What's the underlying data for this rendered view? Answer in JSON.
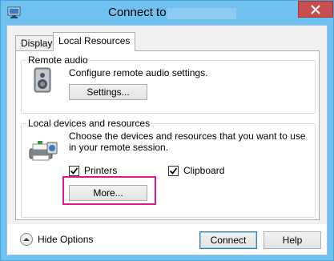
{
  "window": {
    "title": "Connect to",
    "close_glyph": "×"
  },
  "tabs": [
    {
      "label": "Display"
    },
    {
      "label": "Local Resources"
    }
  ],
  "remote_audio": {
    "legend": "Remote audio",
    "description": "Configure remote audio settings.",
    "settings_button": "Settings...",
    "icon": "speaker-icon"
  },
  "local_devices": {
    "legend": "Local devices and resources",
    "description": "Choose the devices and resources that you want to use in your remote session.",
    "printers_label": "Printers",
    "printers_checked": true,
    "clipboard_label": "Clipboard",
    "clipboard_checked": true,
    "more_button": "More...",
    "icon": "devices-icon"
  },
  "footer": {
    "hide_options": "Hide Options",
    "connect_button": "Connect",
    "help_button": "Help"
  },
  "colors": {
    "titlebar": "#6fc1f0",
    "close_button": "#c74f4f",
    "highlight": "#e0198e"
  }
}
